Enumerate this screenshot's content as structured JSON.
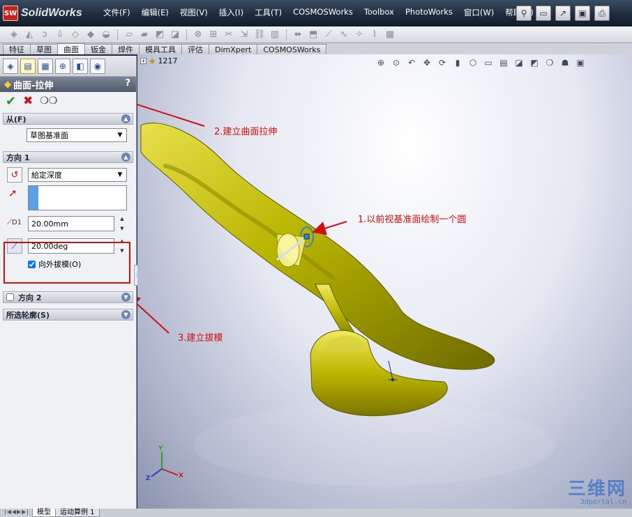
{
  "app": {
    "logo_mark": "SW",
    "name": "SolidWorks"
  },
  "menu": [
    "文件(F)",
    "编辑(E)",
    "视图(V)",
    "插入(I)",
    "工具(T)",
    "COSMOSWorks",
    "Toolbox",
    "PhotoWorks",
    "窗口(W)",
    "帮助(H)"
  ],
  "command_tabs": [
    {
      "label": "特征",
      "active": false
    },
    {
      "label": "草图",
      "active": false
    },
    {
      "label": "曲面",
      "active": true
    },
    {
      "label": "钣金",
      "active": false
    },
    {
      "label": "焊件",
      "active": false
    },
    {
      "label": "模具工具",
      "active": false
    },
    {
      "label": "评估",
      "active": false
    },
    {
      "label": "DimXpert",
      "active": false
    },
    {
      "label": "COSMOSWorks",
      "active": false
    }
  ],
  "property_manager": {
    "title": "曲面-拉伸",
    "help": "?",
    "from_group": {
      "label": "从(F)",
      "value": "草图基准面"
    },
    "direction1": {
      "label": "方向 1",
      "end_condition": "給定深度",
      "depth": "20.00mm",
      "depth_label": "D1",
      "draft_angle": "20.00deg",
      "draft_outward_label": "向外拔模(O)",
      "draft_outward_checked": true
    },
    "direction2": {
      "label": "方向 2",
      "checked": false
    },
    "selected_contours": {
      "label": "所选轮廓(S)"
    }
  },
  "graphics": {
    "tree_item": "1217",
    "annotations": {
      "a1": "1.以前视基准面绘制一个圆",
      "a2": "2.建立曲面拉伸",
      "a3": "3.建立拔模"
    },
    "triad": {
      "x": "X",
      "y": "Y",
      "z": "Z"
    }
  },
  "bottom_tabs": [
    {
      "label": "模型",
      "active": true
    },
    {
      "label": "运动算例 1",
      "active": false
    }
  ],
  "watermark": {
    "cn": "三维网",
    "url": "3dportal.cn"
  },
  "colors": {
    "model": "#b8b400",
    "annotation": "#d01010",
    "highlight_box": "#d01010"
  }
}
